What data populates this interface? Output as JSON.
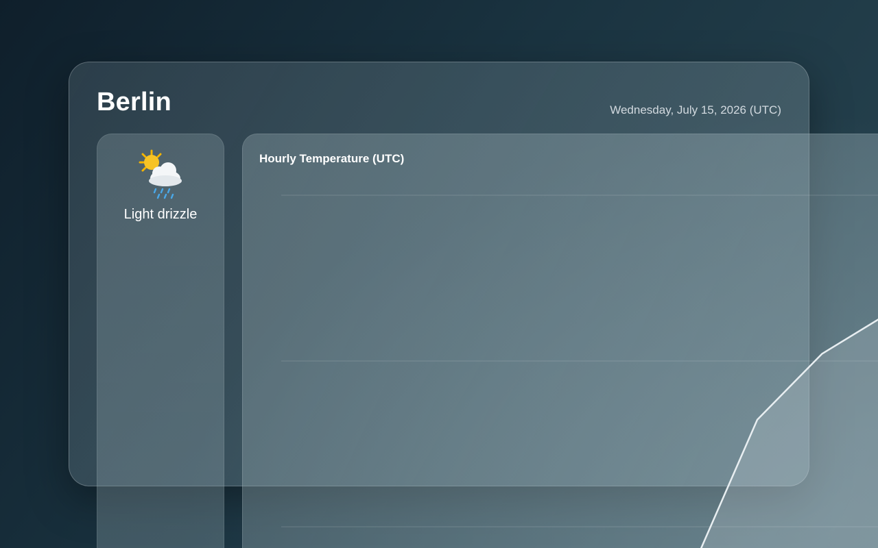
{
  "header": {
    "city": "Berlin",
    "date": "Wednesday, July 15, 2026 (UTC)"
  },
  "current": {
    "condition": "Light drizzle",
    "icon": "sun-behind-rain-cloud-icon"
  },
  "chart": {
    "title": "Hourly Temperature (UTC)"
  },
  "chart_data": {
    "type": "area",
    "title": "Hourly Temperature (UTC)",
    "grid": true,
    "line_color": "#e8eef1",
    "points": [
      [
        0.0,
        0.0
      ],
      [
        0.02,
        0.08
      ],
      [
        0.1,
        0.58
      ],
      [
        0.19,
        0.83
      ],
      [
        0.28,
        0.98
      ],
      [
        0.3,
        1.0
      ]
    ]
  },
  "colors": {
    "background": "#1a3340",
    "text": "#ffffff"
  }
}
